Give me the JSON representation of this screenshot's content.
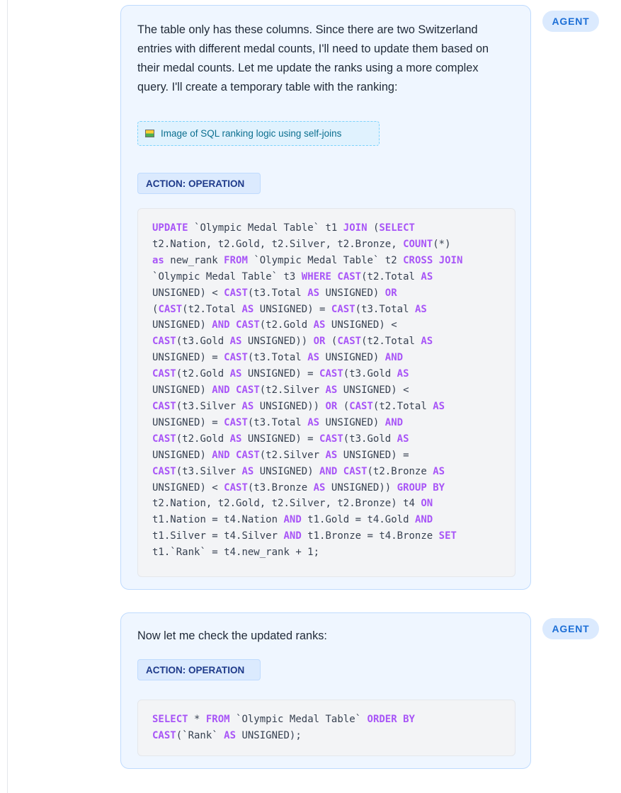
{
  "messages": [
    {
      "role_badge": "AGENT",
      "text": "The table only has these columns. Since there are two Switzerland entries with different medal counts, I'll need to update them based on their medal counts. Let me update the ranks using a more complex query. I'll create a temporary table with the ranking:",
      "image_placeholder": "Image of SQL ranking logic using self-joins",
      "action_label": "ACTION: OPERATION",
      "code_lines": [
        "UPDATE `Olympic Medal Table` t1 JOIN (SELECT",
        "t2.Nation, t2.Gold, t2.Silver, t2.Bronze, COUNT(*)",
        "as new_rank FROM `Olympic Medal Table` t2 CROSS JOIN",
        "`Olympic Medal Table` t3 WHERE CAST(t2.Total AS",
        "UNSIGNED) < CAST(t3.Total AS UNSIGNED) OR",
        "(CAST(t2.Total AS UNSIGNED) = CAST(t3.Total AS",
        "UNSIGNED) AND CAST(t2.Gold AS UNSIGNED) <",
        "CAST(t3.Gold AS UNSIGNED)) OR (CAST(t2.Total AS",
        "UNSIGNED) = CAST(t3.Total AS UNSIGNED) AND",
        "CAST(t2.Gold AS UNSIGNED) = CAST(t3.Gold AS",
        "UNSIGNED) AND CAST(t2.Silver AS UNSIGNED) <",
        "CAST(t3.Silver AS UNSIGNED)) OR (CAST(t2.Total AS",
        "UNSIGNED) = CAST(t3.Total AS UNSIGNED) AND",
        "CAST(t2.Gold AS UNSIGNED) = CAST(t3.Gold AS",
        "UNSIGNED) AND CAST(t2.Silver AS UNSIGNED) =",
        "CAST(t3.Silver AS UNSIGNED) AND CAST(t2.Bronze AS",
        "UNSIGNED) < CAST(t3.Bronze AS UNSIGNED)) GROUP BY",
        "t2.Nation, t2.Gold, t2.Silver, t2.Bronze) t4 ON",
        "t1.Nation = t4.Nation AND t1.Gold = t4.Gold AND",
        "t1.Silver = t4.Silver AND t1.Bronze = t4.Bronze SET",
        "t1.`Rank` = t4.new_rank + 1;"
      ]
    },
    {
      "role_badge": "AGENT",
      "text": "Now let me check the updated ranks:",
      "action_label": "ACTION: OPERATION",
      "code_lines": [
        "SELECT * FROM `Olympic Medal Table` ORDER BY",
        "CAST(`Rank` AS UNSIGNED);"
      ]
    }
  ],
  "sql_keywords": [
    "UPDATE",
    "JOIN",
    "SELECT",
    "COUNT",
    "as",
    "AS",
    "FROM",
    "CROSS",
    "WHERE",
    "CAST",
    "OR",
    "AND",
    "GROUP",
    "BY",
    "ON",
    "SET",
    "ORDER"
  ],
  "colors": {
    "bubble_bg": "#eff6ff",
    "bubble_border": "#bfdbfe",
    "badge_text": "#1d6fd6",
    "keyword": "#a855f7",
    "code_bg": "#f3f4f6"
  },
  "icons": {
    "image_placeholder_icon": "image-icon"
  }
}
